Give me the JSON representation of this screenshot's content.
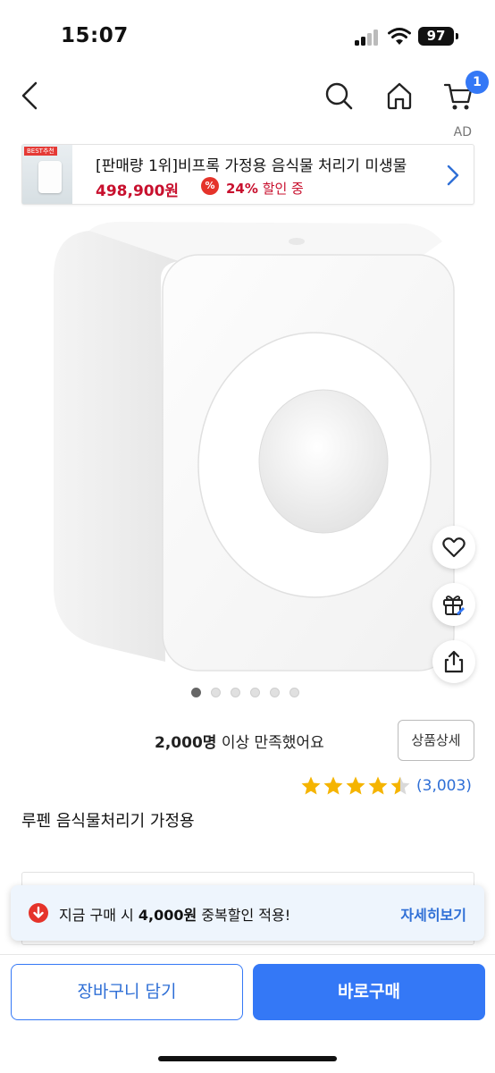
{
  "status_bar": {
    "time": "15:07",
    "battery": "97"
  },
  "nav": {
    "cart_count": "1"
  },
  "ad": {
    "label": "AD",
    "badge": "BEST추천",
    "title": "[판매량 1위]비프록 가정용 음식물 처리기 미생물",
    "price": "498,900원",
    "pct_icon": "%",
    "discount": "24%",
    "discount_suffix": "할인 중"
  },
  "gallery": {
    "total": 6,
    "active": 0
  },
  "satisfaction": {
    "count": "2,000명",
    "text": "이상 만족했어요"
  },
  "detail_button": "상품상세",
  "rating": {
    "value": 4.5,
    "count": "(3,003)"
  },
  "product": {
    "name": "루펜 음식물처리기 가정용"
  },
  "toast": {
    "prefix": "지금 구매 시",
    "amount": "4,000원",
    "suffix": "중복할인 적용!",
    "link": "자세히보기"
  },
  "actions": {
    "cart": "장바구니 담기",
    "buy": "바로구매"
  },
  "icons": [
    "back-icon",
    "search-icon",
    "home-icon",
    "cart-icon",
    "heart-icon",
    "gift-icon",
    "share-icon",
    "chevron-right-icon",
    "arrow-down-icon",
    "star-icon"
  ],
  "colors": {
    "accent": "#3478f6",
    "price_red": "#c8102e",
    "link_blue": "#2f6fd6"
  }
}
